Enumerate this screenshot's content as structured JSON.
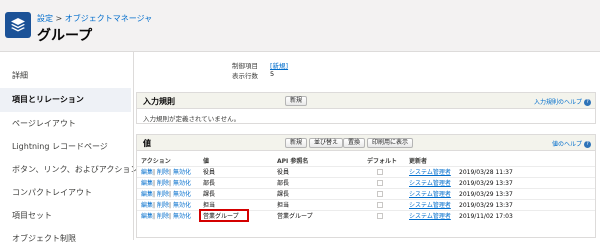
{
  "header": {
    "breadcrumb_link": "設定",
    "breadcrumb_sep": " > ",
    "breadcrumb_current": "オブジェクトマネージャ",
    "title": "グループ"
  },
  "sidebar": {
    "items": [
      {
        "label": "詳細"
      },
      {
        "label": "項目とリレーション"
      },
      {
        "label": "ページレイアウト"
      },
      {
        "label": "Lightning レコードページ"
      },
      {
        "label": "ボタン、リンク、およびアクション"
      },
      {
        "label": "コンパクトレイアウト"
      },
      {
        "label": "項目セット"
      },
      {
        "label": "オブジェクト制限"
      }
    ]
  },
  "properties": {
    "control_label": "制御項目",
    "control_value": "[新規]",
    "rows_label": "表示行数",
    "rows_value": "5"
  },
  "input_rules": {
    "title": "入力規則",
    "new_button": "新規",
    "help_label": "入力規則のヘルプ",
    "empty_message": "入力規則が定義されていません。"
  },
  "values": {
    "title": "値",
    "buttons": {
      "new": "新規",
      "reorder": "並び替え",
      "replace": "置換",
      "print": "印刷用に表示"
    },
    "help_label": "値のヘルプ",
    "columns": {
      "action": "アクション",
      "value": "値",
      "api": "API 参照名",
      "default": "デフォルト",
      "modified": "更新者"
    },
    "rows": [
      {
        "actions": [
          "編集",
          "削除",
          "無効化"
        ],
        "value": "役員",
        "api": "役員",
        "user": "システム管理者",
        "date": "2019/03/28 11:37"
      },
      {
        "actions": [
          "編集",
          "削除",
          "無効化"
        ],
        "value": "部長",
        "api": "部長",
        "user": "システム管理者",
        "date": "2019/03/29 13:37"
      },
      {
        "actions": [
          "編集",
          "削除",
          "無効化"
        ],
        "value": "課長",
        "api": "課長",
        "user": "システム管理者",
        "date": "2019/03/29 13:37"
      },
      {
        "actions": [
          "編集",
          "削除",
          "無効化"
        ],
        "value": "担当",
        "api": "担当",
        "user": "システム管理者",
        "date": "2019/03/29 13:37"
      },
      {
        "actions": [
          "編集",
          "削除",
          "無効化"
        ],
        "value": "営業グループ",
        "api": "営業グループ",
        "user": "システム管理者",
        "date": "2019/11/02 17:03"
      }
    ]
  },
  "colors": {
    "accent": "#1b5297",
    "link": "#006dcc",
    "highlight": "#d40000"
  },
  "icons": {
    "app": "layers-icon",
    "help": "question-circle-icon"
  }
}
